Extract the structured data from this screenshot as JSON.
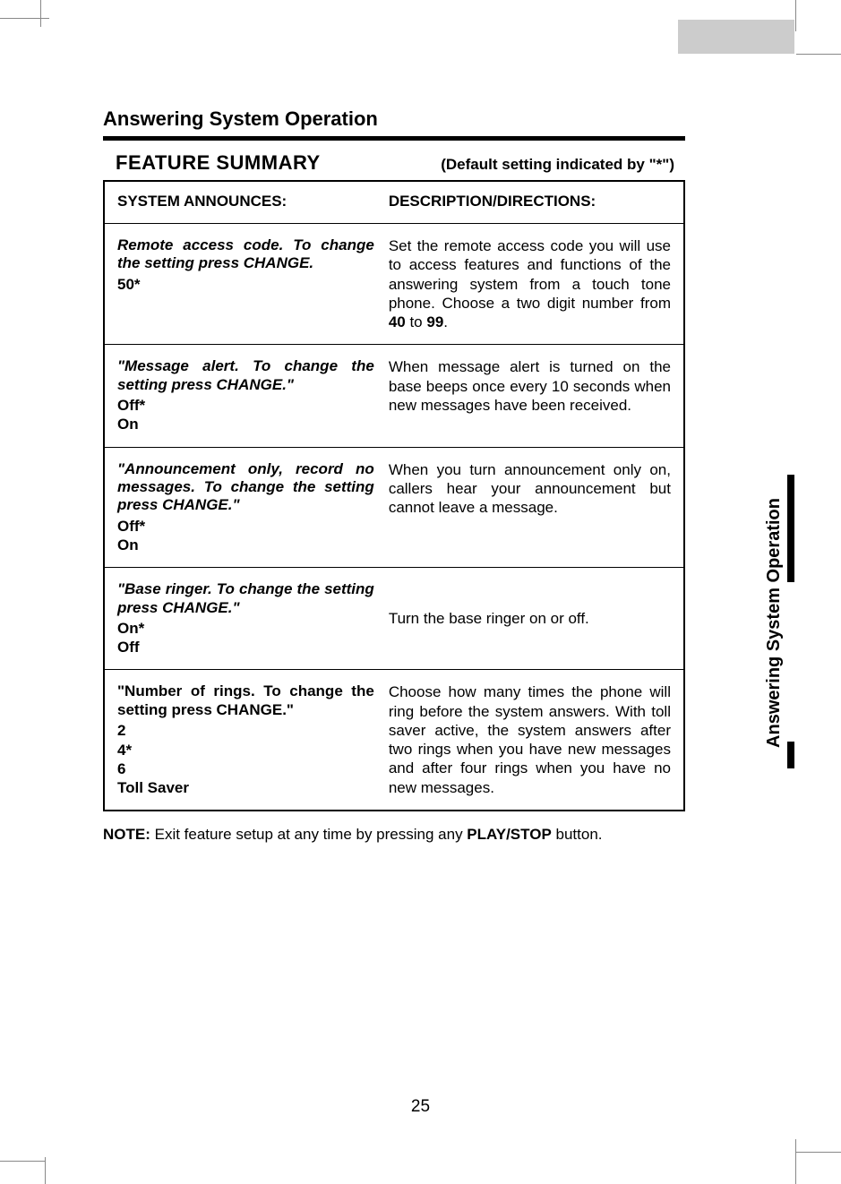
{
  "section_title": "Answering System Operation",
  "feature_title": "FEATURE  SUMMARY",
  "default_note": "(Default setting indicated by \"*\")",
  "header_left": "SYSTEM ANNOUNCES:",
  "header_right": "DESCRIPTION/DIRECTIONS:",
  "rows": [
    {
      "announce": "Remote access code. To change the setting press CHANGE.",
      "options": "50*",
      "description_pre": "Set the remote access code you will use to access features and functions of the answering system from a touch tone phone. Choose a two digit number from ",
      "description_b1": "40",
      "description_mid": " to ",
      "description_b2": "99",
      "description_post": "."
    },
    {
      "announce": "\"Message alert. To change the setting press CHANGE.\"",
      "options": "Off*\nOn",
      "description": "When message alert is turned on the base beeps once every 10 seconds when new messages have been received."
    },
    {
      "announce": "\"Announcement only, record no messages. To change the setting press CHANGE.\"",
      "options": "Off*\nOn",
      "description": "When you turn announcement only on, callers hear your announcement but cannot leave a message."
    },
    {
      "announce": "\"Base ringer. To change the setting press CHANGE.\"",
      "options": "On*\nOff",
      "description": "Turn the base ringer on or off."
    },
    {
      "announce_noitalic": "\"Number of rings. To change the setting press CHANGE.\"",
      "options": "2\n4*\n6\nToll Saver",
      "description": "Choose how many times the phone will ring before the system answers. With toll saver active, the system  answers after two rings when you have new messages and after four rings when you have no new messages."
    }
  ],
  "note_label": "NOTE:",
  "note_text": " Exit feature setup at any time by pressing any ",
  "note_bold": "PLAY/STOP",
  "note_end": " button.",
  "page_number": "25",
  "side_tab": "Answering System Operation"
}
